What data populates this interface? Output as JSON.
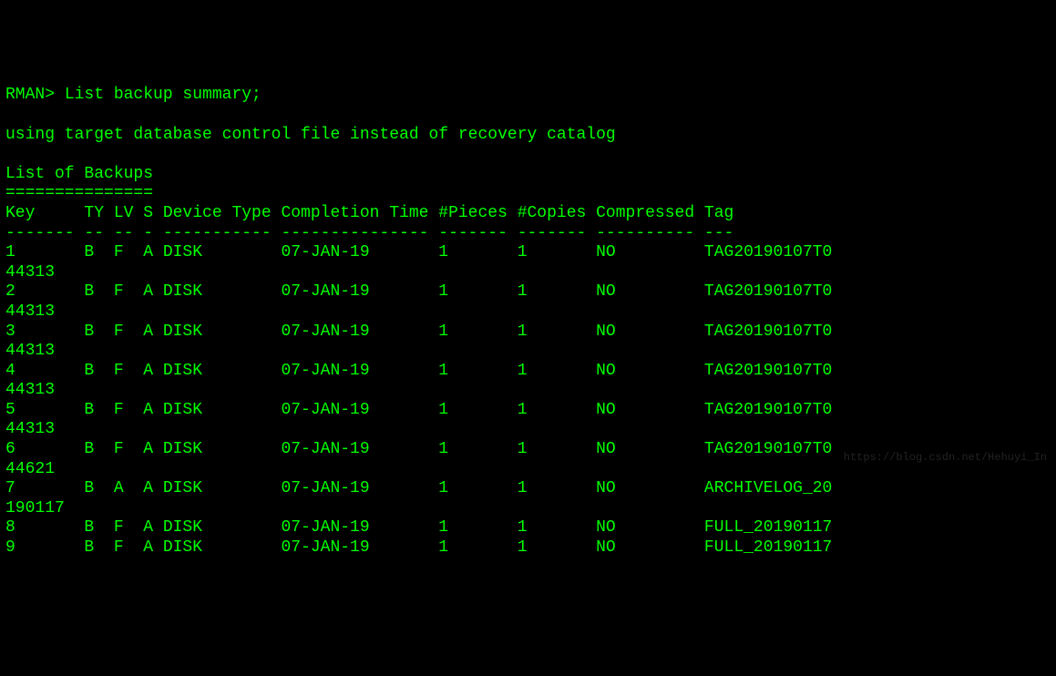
{
  "prompt": "RMAN> ",
  "command": "List backup summary;",
  "message": "using target database control file instead of recovery catalog",
  "section_title": "List of Backups",
  "section_underline": "===============",
  "headers": {
    "key": "Key",
    "ty": "TY",
    "lv": "LV",
    "s": "S",
    "device": "Device Type",
    "completion": "Completion Time",
    "pieces": "#Pieces",
    "copies": "#Copies",
    "compressed": "Compressed",
    "tag": "Tag"
  },
  "divider": "------- -- -- - ----------- --------------- ------- ------- ---------- ---",
  "rows": [
    {
      "key": "1",
      "ty": "B",
      "lv": "F",
      "s": "A",
      "device": "DISK",
      "completion": "07-JAN-19",
      "pieces": "1",
      "copies": "1",
      "compressed": "NO",
      "tag": "TAG20190107T0",
      "wrap": "44313"
    },
    {
      "key": "2",
      "ty": "B",
      "lv": "F",
      "s": "A",
      "device": "DISK",
      "completion": "07-JAN-19",
      "pieces": "1",
      "copies": "1",
      "compressed": "NO",
      "tag": "TAG20190107T0",
      "wrap": "44313"
    },
    {
      "key": "3",
      "ty": "B",
      "lv": "F",
      "s": "A",
      "device": "DISK",
      "completion": "07-JAN-19",
      "pieces": "1",
      "copies": "1",
      "compressed": "NO",
      "tag": "TAG20190107T0",
      "wrap": "44313"
    },
    {
      "key": "4",
      "ty": "B",
      "lv": "F",
      "s": "A",
      "device": "DISK",
      "completion": "07-JAN-19",
      "pieces": "1",
      "copies": "1",
      "compressed": "NO",
      "tag": "TAG20190107T0",
      "wrap": "44313"
    },
    {
      "key": "5",
      "ty": "B",
      "lv": "F",
      "s": "A",
      "device": "DISK",
      "completion": "07-JAN-19",
      "pieces": "1",
      "copies": "1",
      "compressed": "NO",
      "tag": "TAG20190107T0",
      "wrap": "44313"
    },
    {
      "key": "6",
      "ty": "B",
      "lv": "F",
      "s": "A",
      "device": "DISK",
      "completion": "07-JAN-19",
      "pieces": "1",
      "copies": "1",
      "compressed": "NO",
      "tag": "TAG20190107T0",
      "wrap": "44621"
    },
    {
      "key": "7",
      "ty": "B",
      "lv": "A",
      "s": "A",
      "device": "DISK",
      "completion": "07-JAN-19",
      "pieces": "1",
      "copies": "1",
      "compressed": "NO",
      "tag": "ARCHIVELOG_20",
      "wrap": "190117"
    },
    {
      "key": "8",
      "ty": "B",
      "lv": "F",
      "s": "A",
      "device": "DISK",
      "completion": "07-JAN-19",
      "pieces": "1",
      "copies": "1",
      "compressed": "NO",
      "tag": "FULL_20190117",
      "wrap": ""
    },
    {
      "key": "9",
      "ty": "B",
      "lv": "F",
      "s": "A",
      "device": "DISK",
      "completion": "07-JAN-19",
      "pieces": "1",
      "copies": "1",
      "compressed": "NO",
      "tag": "FULL_20190117",
      "wrap": ""
    }
  ],
  "watermark": "https://blog.csdn.net/Hehuyi_In"
}
